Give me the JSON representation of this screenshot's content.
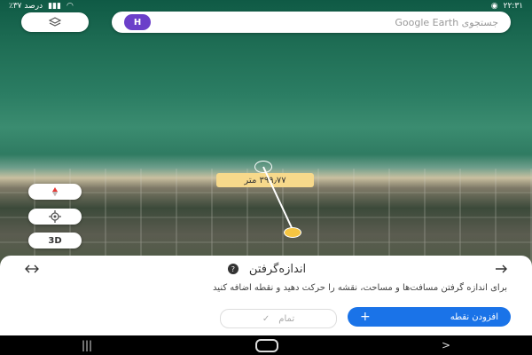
{
  "status_bar": {
    "time": "۲۲:۳۱",
    "battery": "٪۳۷ درصد"
  },
  "search": {
    "avatar_letter": "H",
    "placeholder": "جستجوی Google Earth"
  },
  "map_controls": {
    "three_d_label": "3D"
  },
  "measurement": {
    "distance_label": "۳۹۹٫۷۷ متر"
  },
  "panel": {
    "title": "اندازه‌گرفتن",
    "description": "برای اندازه گرفتن مسافت‌ها و مساحت، نقشه را حرکت دهید و نقطه اضافه کنید",
    "done_label": "تمام",
    "add_point_label": "افزودن نقطه"
  },
  "colors": {
    "accent": "#1a73e8",
    "avatar": "#6b3fc9",
    "label_bg": "#f7d98b"
  }
}
